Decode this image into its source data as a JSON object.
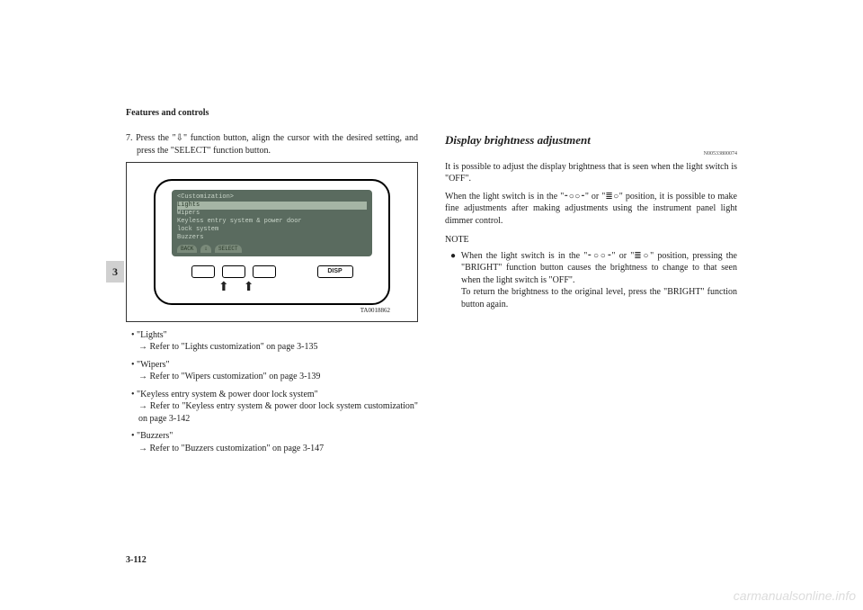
{
  "header": "Features and controls",
  "side_tab": "3",
  "page_number": "3-112",
  "watermark": "carmanualsonline.info",
  "left": {
    "step": "7. Press the \"⇩\" function button, align the cursor with the desired setting, and press the \"SELECT\" function button.",
    "diagram": {
      "title": "<Customization>",
      "items": [
        "Lights",
        "Wipers",
        "Keyless entry system & power door",
        "lock system",
        "Buzzers"
      ],
      "footer_left": "BACK",
      "footer_mid": "⇩",
      "footer_right": "SELECT",
      "disp": "DISP",
      "id": "TA0018862"
    },
    "bullets": [
      {
        "label": "• \"Lights\"",
        "refer": "→ Refer to \"Lights customization\" on page 3-135"
      },
      {
        "label": "• \"Wipers\"",
        "refer": "→ Refer to \"Wipers customization\" on page 3-139"
      },
      {
        "label": "• \"Keyless entry system & power door lock system\"",
        "refer": "→ Refer to \"Keyless entry system & power door lock system customization\" on page 3-142"
      },
      {
        "label": "• \"Buzzers\"",
        "refer": "→ Refer to \"Buzzers customization\" on page 3-147"
      }
    ]
  },
  "right": {
    "heading": "Display brightness adjustment",
    "doc_code": "N00533800074",
    "para1": "It is possible to adjust the display brightness that is seen when the light switch is \"OFF\".",
    "para2": "When the light switch is in the \"⁃○○⁃\" or \"≣○\" position, it is possible to make fine adjustments after making adjustments using the instrument panel light dimmer control.",
    "note_title": "NOTE",
    "note_bullet": "● When the light switch is in the \"⁃○○⁃\" or \"≣○\" position, pressing the \"BRIGHT\" function button causes the brightness to change to that seen when the light switch is \"OFF\".",
    "note_cont": "To return the brightness to the original level, press the \"BRIGHT\" function button again."
  }
}
